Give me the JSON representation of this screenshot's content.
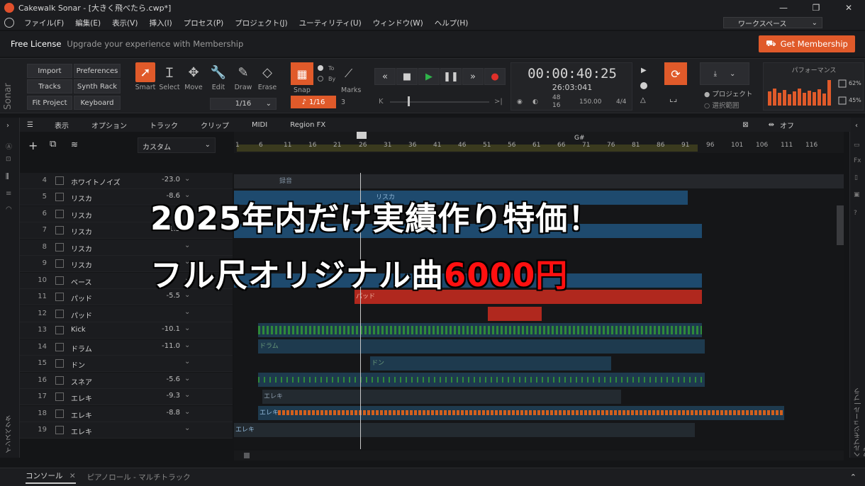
{
  "window": {
    "title": "Cakewalk Sonar - [大きく飛べたら.cwp*]"
  },
  "menu": [
    "ファイル(F)",
    "編集(E)",
    "表示(V)",
    "挿入(I)",
    "プロセス(P)",
    "プロジェクト(J)",
    "ユーティリティ(U)",
    "ウィンドウ(W)",
    "ヘルプ(H)"
  ],
  "workspace": "ワークスペース",
  "license": {
    "free": "Free License",
    "upgrade": "Upgrade your experience with Membership",
    "button": "Get Membership"
  },
  "sonar_logo": "Sonar",
  "control_buttons": [
    "Import",
    "Preferences",
    "Tracks",
    "Synth Rack",
    "Fit Project",
    "Keyboard"
  ],
  "tools": [
    "Smart",
    "Select",
    "Move",
    "Edit",
    "Draw",
    "Erase"
  ],
  "snap": {
    "label": "Snap",
    "value": "1/16",
    "dropdown": "1/16",
    "to": "To",
    "by": "By",
    "marks": "Marks",
    "marks_count": "3"
  },
  "time": {
    "main": "00:00:40:25",
    "sub": "26:03:041",
    "tempo_top": "48",
    "tempo_bottom": "16",
    "bpm": "150.00",
    "meter": "4/4"
  },
  "loop_options": [
    "プロジェクト",
    "選択範囲"
  ],
  "performance": {
    "title": "パフォーマンス",
    "pct1": "62%",
    "pct2": "45%"
  },
  "track_toolbar": {
    "view": "表示",
    "options": "オプション",
    "track": "トラック",
    "clip": "クリップ",
    "midi": "MIDI",
    "region_fx": "Region FX",
    "off": "オフ",
    "preset": "カスタム"
  },
  "timeline": {
    "bars": [
      "1",
      "6",
      "11",
      "16",
      "21",
      "26",
      "31",
      "36",
      "41",
      "46",
      "51",
      "56",
      "61",
      "66",
      "71",
      "76",
      "81",
      "86",
      "91",
      "96",
      "101",
      "106",
      "111",
      "116"
    ],
    "marker": "G#"
  },
  "tracks": [
    {
      "num": "4",
      "name": "ホワイトノイズ",
      "vol": "-23.0"
    },
    {
      "num": "5",
      "name": "リスカ",
      "vol": "-8.6"
    },
    {
      "num": "6",
      "name": "リスカ",
      "vol": ""
    },
    {
      "num": "7",
      "name": "リスカ",
      "vol": "-11.5"
    },
    {
      "num": "8",
      "name": "リスカ",
      "vol": ""
    },
    {
      "num": "9",
      "name": "リスカ",
      "vol": ""
    },
    {
      "num": "10",
      "name": "ベース",
      "vol": ""
    },
    {
      "num": "11",
      "name": "パッド",
      "vol": "-5.5"
    },
    {
      "num": "12",
      "name": "パッド",
      "vol": ""
    },
    {
      "num": "13",
      "name": "Kick",
      "vol": "-10.1"
    },
    {
      "num": "14",
      "name": "ドラム",
      "vol": "-11.0"
    },
    {
      "num": "15",
      "name": "ドン",
      "vol": ""
    },
    {
      "num": "16",
      "name": "スネア",
      "vol": "-5.6"
    },
    {
      "num": "17",
      "name": "エレキ",
      "vol": "-9.3"
    },
    {
      "num": "18",
      "name": "エレキ",
      "vol": "-8.8"
    },
    {
      "num": "19",
      "name": "エレキ",
      "vol": ""
    }
  ],
  "clip_labels": {
    "c1": "録音",
    "c2": "ドラム",
    "c3": "ドン",
    "c4": "エレキ",
    "c5": "エレキ",
    "c6": "エレキ",
    "c7": "パッド",
    "c8": "リスカ"
  },
  "side_labels": {
    "inspector": "インスペクタ",
    "browser": "ヘルプモジュール | ブラウザ"
  },
  "bottom_tabs": [
    "コンソール",
    "ピアノロール - マルチトラック"
  ],
  "overlay": {
    "line1": "2025年内だけ実績作り特価！",
    "line2_main": "フル尺オリジナル曲",
    "line2_price": "6000円"
  },
  "colors": {
    "accent": "#e05a2a",
    "price": "#ff1010",
    "clip_blue": "#1e4a6e",
    "clip_green": "#2e8a3a",
    "clip_orange": "#d2601e",
    "clip_red": "#b0281e"
  }
}
